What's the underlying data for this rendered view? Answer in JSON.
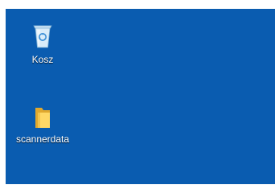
{
  "desktop": {
    "background_color": "#0a5cb0",
    "icons": [
      {
        "label": "Kosz",
        "icon": "recycle-bin-icon"
      },
      {
        "label": "scannerdata",
        "icon": "folder-icon"
      }
    ]
  }
}
